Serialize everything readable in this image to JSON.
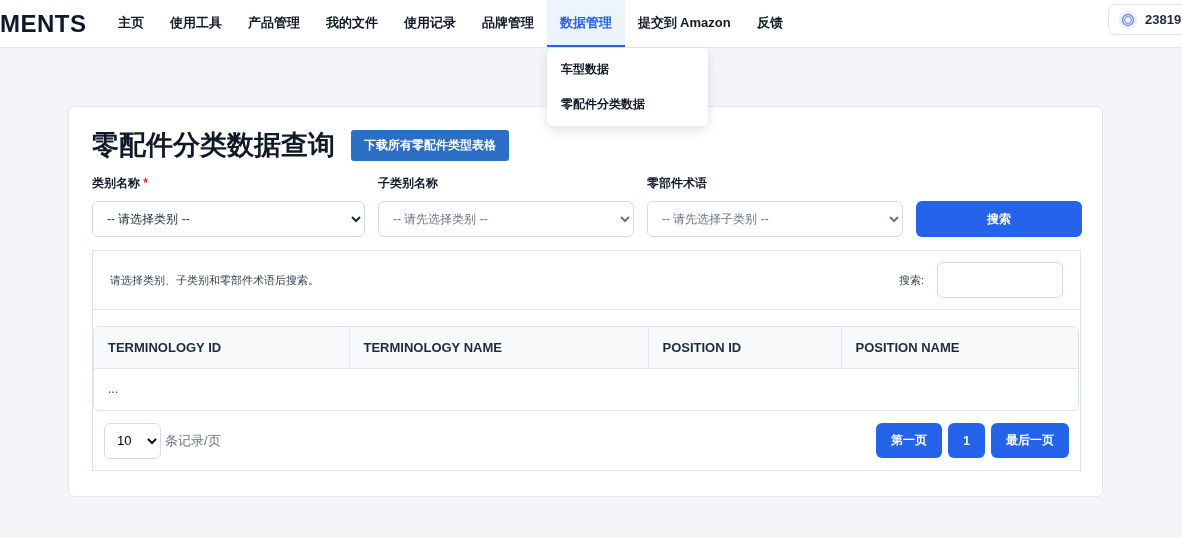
{
  "logo": "MENTS",
  "nav": [
    {
      "label": "主页",
      "selected": false
    },
    {
      "label": "使用工具",
      "selected": false
    },
    {
      "label": "产品管理",
      "selected": false
    },
    {
      "label": "我的文件",
      "selected": false
    },
    {
      "label": "使用记录",
      "selected": false
    },
    {
      "label": "品牌管理",
      "selected": false
    },
    {
      "label": "数据管理",
      "selected": true,
      "menu": [
        "车型数据",
        "零配件分类数据"
      ]
    },
    {
      "label": "提交到 Amazon",
      "selected": false
    },
    {
      "label": "反馈",
      "selected": false
    }
  ],
  "credits": "23819",
  "page": {
    "title": "零配件分类数据查询",
    "download_button": "下载所有零配件类型表格",
    "filters": [
      {
        "label": "类别名称",
        "required_mark": "*",
        "value": "-- 请选择类别 --",
        "disabled": false
      },
      {
        "label": "子类别名称",
        "value": "-- 请先选择类别 --",
        "disabled": true
      },
      {
        "label": "零部件术语",
        "value": "-- 请先选择子类别 --",
        "disabled": true
      }
    ],
    "search_button": "搜索",
    "hint": "请选择类别、子类别和零部件术语后搜索。",
    "search_label": "搜索:",
    "table": {
      "columns": [
        "TERMINOLOGY ID",
        "TERMINOLOGY NAME",
        "POSITION ID",
        "POSITION NAME"
      ],
      "empty_text": "..."
    },
    "page_size": "10",
    "page_size_label": "条记录/页",
    "pager": [
      "第一页",
      "1",
      "最后一页"
    ]
  }
}
